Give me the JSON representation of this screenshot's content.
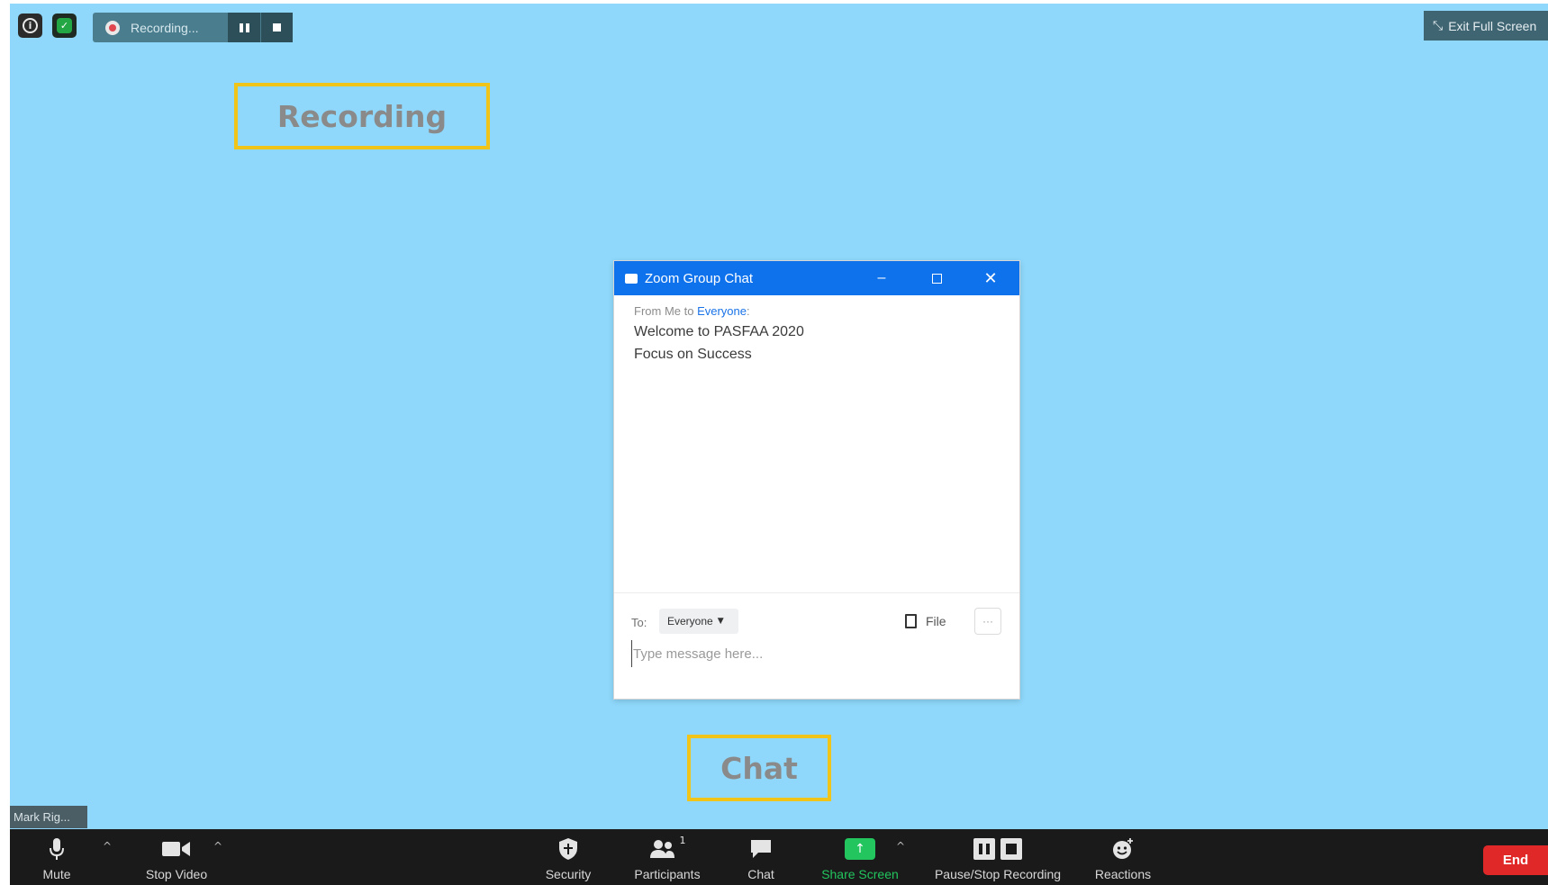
{
  "status": {
    "info_icon": "info-icon",
    "security_icon": "shield-check-icon",
    "recording_text": "Recording..."
  },
  "exit_full_screen": "Exit Full Screen",
  "callouts": {
    "recording": "Recording",
    "chat": "Chat"
  },
  "chat_window": {
    "title": "Zoom Group Chat",
    "message": {
      "from_prefix": "From Me to ",
      "recipient": "Everyone",
      "recipient_suffix": ":",
      "lines": [
        "Welcome to PASFAA 2020",
        "Focus on Success"
      ]
    },
    "to_label": "To:",
    "to_value": "Everyone",
    "file_label": "File",
    "more_label": "···",
    "input_placeholder": "Type message here..."
  },
  "participant_name": "Mark Rig...",
  "toolbar": {
    "mute": "Mute",
    "stop_video": "Stop Video",
    "security": "Security",
    "participants": "Participants",
    "participants_count": "1",
    "chat": "Chat",
    "share_screen": "Share Screen",
    "pause_stop_recording": "Pause/Stop Recording",
    "reactions": "Reactions",
    "end": "End"
  },
  "colors": {
    "background": "#8fd8fb",
    "title_bar": "#0e72ed",
    "share_green": "#22c55e",
    "end_red": "#e02828",
    "callout_border": "#f0c419"
  }
}
